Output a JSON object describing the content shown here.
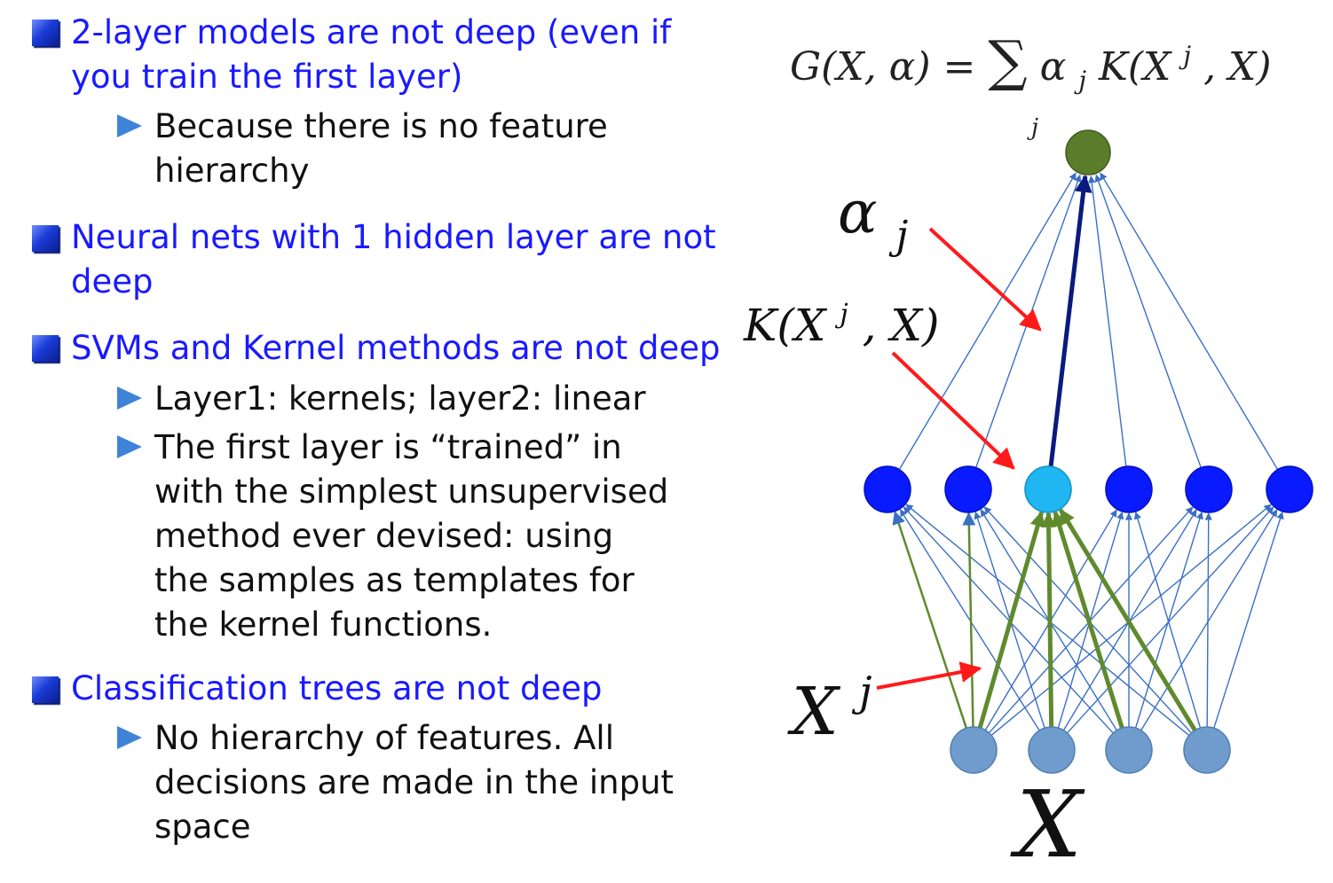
{
  "bullets": [
    {
      "heading_lines": [
        "2-layer models are not deep (even if",
        "you train the first layer)"
      ],
      "subs": [
        {
          "lines": [
            "Because there is no feature",
            "hierarchy"
          ]
        }
      ]
    },
    {
      "heading_lines": [
        "Neural nets with 1 hidden layer are not",
        "deep"
      ],
      "subs": []
    },
    {
      "heading_lines": [
        "SVMs and Kernel methods are not deep"
      ],
      "subs": [
        {
          "lines": [
            "Layer1: kernels; layer2: linear"
          ]
        },
        {
          "lines": [
            "The first layer is “trained” in",
            "with the simplest unsupervised",
            "method ever devised: using",
            "the samples as templates for",
            "the kernel functions."
          ]
        }
      ]
    },
    {
      "heading_lines": [
        "Classification trees are not deep"
      ],
      "subs": [
        {
          "lines": [
            "No hierarchy of features. All",
            "decisions are made in the input",
            "space"
          ]
        }
      ]
    }
  ],
  "diagram": {
    "formula": {
      "lhs": "G(X, α) = ",
      "sum": "∑",
      "sum_sub": "j",
      "rhs_a": "α",
      "rhs_a_sub": "j",
      "rhs_k": "K(X",
      "rhs_k_sup": "j",
      "rhs_end": ", X)"
    },
    "label_alpha": "α",
    "label_alpha_sub": "j",
    "label_kernel": "K(X",
    "label_kernel_sup": "j",
    "label_kernel_end": ", X)",
    "label_xj": "X",
    "label_xj_sup": "j",
    "label_x": "X",
    "counts": {
      "inputs": 4,
      "hidden": 6,
      "outputs": 1
    },
    "highlight_hidden_index": 2,
    "highlight_input_index": 0,
    "colors": {
      "output_node": "#5a7d2b",
      "hidden_node": "#0a1aff",
      "hidden_highlight": "#1fb6f2",
      "input_node": "#6f9ccc",
      "thin_edge": "#3a6fc4",
      "strong_top_edge": "#0b1a7e",
      "green_edge": "#5f8a2d",
      "annotation_arrow": "#ff1a1a",
      "bullet_heading": "#1a1aff",
      "bullet_text": "#111111"
    }
  }
}
